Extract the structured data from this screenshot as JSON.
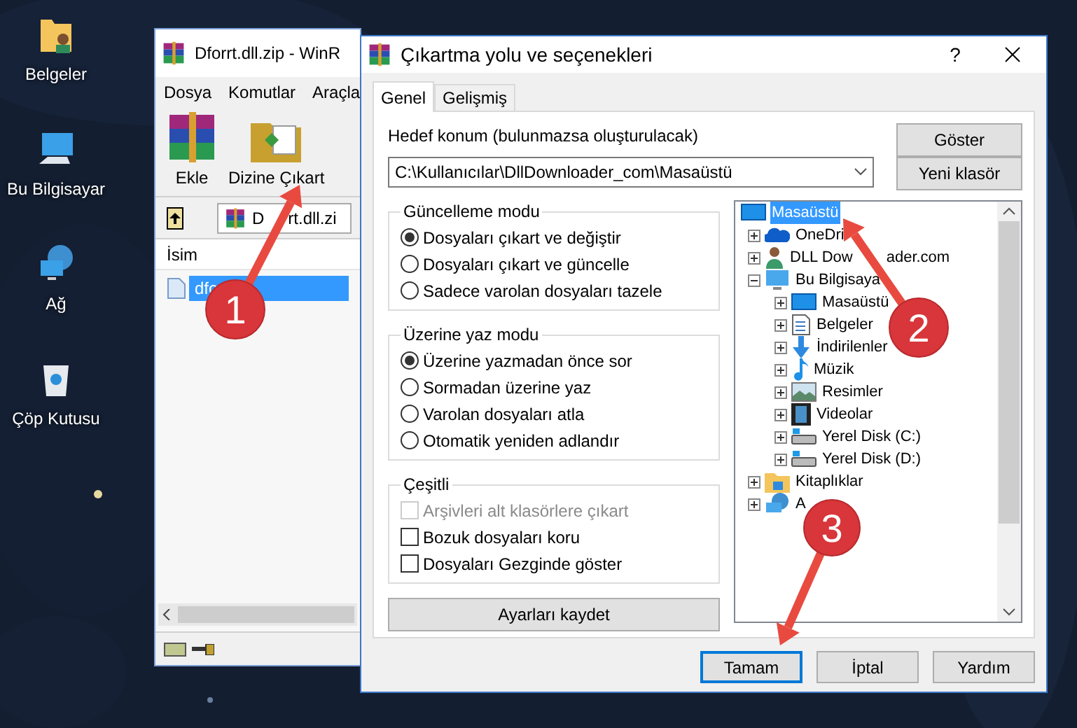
{
  "desktop_icons": [
    {
      "label": "Belgeler",
      "kind": "documents"
    },
    {
      "label": "Bu Bilgisayar",
      "kind": "computer"
    },
    {
      "label": "Ağ",
      "kind": "network"
    },
    {
      "label": "Çöp Kutusu",
      "kind": "recycle"
    }
  ],
  "winrar": {
    "title": "Dforrt.dll.zip - WinR",
    "menu": [
      "Dosya",
      "Komutlar",
      "Araçla"
    ],
    "toolbar": [
      "Ekle",
      "Dizine Çıkart"
    ],
    "path": "D",
    "path_tail": "rt.dll.zi",
    "column": "İsim",
    "file": {
      "name": "dfo",
      "selected": true
    }
  },
  "dialog": {
    "title": "Çıkartma yolu ve seçenekleri",
    "help": "?",
    "tabs": [
      {
        "label": "Genel",
        "selected": true
      },
      {
        "label": "Gelişmiş",
        "selected": false
      }
    ],
    "destination_label": "Hedef konum (bulunmazsa oluşturulacak)",
    "destination_value": "C:\\Kullanıcılar\\DllDownloader_com\\Masaüstü",
    "side_buttons": [
      "Göster",
      "Yeni klasör"
    ],
    "groups": [
      {
        "title": "Güncelleme modu",
        "options": [
          {
            "kind": "radio",
            "label": "Dosyaları çıkart ve değiştir",
            "selected": true
          },
          {
            "kind": "radio",
            "label": "Dosyaları çıkart ve güncelle",
            "selected": false
          },
          {
            "kind": "radio",
            "label": "Sadece varolan dosyaları tazele",
            "selected": false
          }
        ]
      },
      {
        "title": "Üzerine yaz modu",
        "options": [
          {
            "kind": "radio",
            "label": "Üzerine yazmadan önce sor",
            "selected": true
          },
          {
            "kind": "radio",
            "label": "Sormadan üzerine yaz",
            "selected": false
          },
          {
            "kind": "radio",
            "label": "Varolan dosyaları atla",
            "selected": false
          },
          {
            "kind": "radio",
            "label": "Otomatik yeniden adlandır",
            "selected": false
          }
        ]
      },
      {
        "title": "Çeşitli",
        "options": [
          {
            "kind": "checkbox",
            "label": "Arşivleri alt klasörlere çıkart",
            "checked": false,
            "disabled": true
          },
          {
            "kind": "checkbox",
            "label": "Bozuk dosyaları koru",
            "checked": false,
            "disabled": false
          },
          {
            "kind": "checkbox",
            "label": "Dosyaları Gezginde göster",
            "checked": false,
            "disabled": false
          }
        ]
      }
    ],
    "save_button": "Ayarları kaydet",
    "tree": [
      {
        "label": "Masaüstü",
        "kind": "desktop",
        "selected": true,
        "children": [
          {
            "label": "OneDri",
            "kind": "cloud",
            "selected": false,
            "expanded": false
          },
          {
            "label": "DLL Dow",
            "label_tail": "ader.com",
            "kind": "user",
            "selected": false,
            "expanded": false
          },
          {
            "label": "Bu Bilgisaya",
            "kind": "computer",
            "selected": false,
            "expanded": true,
            "children": [
              {
                "label": "Masaüstü",
                "kind": "desktop",
                "selected": false,
                "expanded": false
              },
              {
                "label": "Belgeler",
                "kind": "documents",
                "selected": false,
                "expanded": false
              },
              {
                "label": "İndirilenler",
                "kind": "downloads",
                "selected": false,
                "expanded": false
              },
              {
                "label": "Müzik",
                "kind": "music",
                "selected": false,
                "expanded": false
              },
              {
                "label": "Resimler",
                "kind": "pictures",
                "selected": false,
                "expanded": false
              },
              {
                "label": "Videolar",
                "kind": "videos",
                "selected": false,
                "expanded": false
              },
              {
                "label": "Yerel Disk (C:)",
                "kind": "drive",
                "selected": false,
                "expanded": false
              },
              {
                "label": "Yerel Disk (D:)",
                "kind": "drive",
                "selected": false,
                "expanded": false
              }
            ]
          },
          {
            "label": "Kitaplıklar",
            "kind": "library",
            "selected": false,
            "expanded": false
          },
          {
            "label": "A",
            "kind": "network",
            "selected": false,
            "expanded": false
          }
        ]
      }
    ],
    "buttons": [
      {
        "label": "Tamam",
        "default": true
      },
      {
        "label": "İptal",
        "default": false
      },
      {
        "label": "Yardım",
        "default": false
      }
    ]
  },
  "callouts": [
    "1",
    "2",
    "3"
  ]
}
